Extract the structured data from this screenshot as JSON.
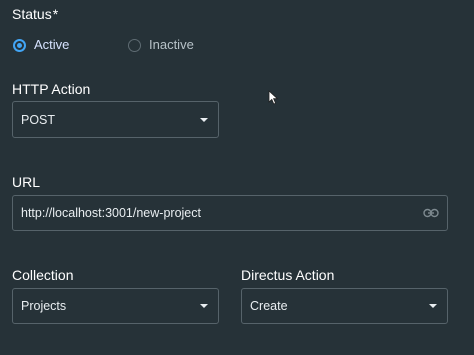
{
  "status": {
    "label": "Status",
    "required_mark": "*",
    "options": [
      {
        "label": "Active",
        "selected": true
      },
      {
        "label": "Inactive",
        "selected": false
      }
    ]
  },
  "http_action": {
    "label": "HTTP Action",
    "value": "POST"
  },
  "url": {
    "label": "URL",
    "value": "http://localhost:3001/new-project"
  },
  "collection": {
    "label": "Collection",
    "value": "Projects"
  },
  "directus_action": {
    "label": "Directus Action",
    "value": "Create"
  },
  "icons": {
    "caret": "chevron-down-icon",
    "url_suffix": "link-icon",
    "cursor": "mouse-pointer-icon"
  },
  "colors": {
    "background": "#263238",
    "accent": "#42a5f5",
    "border": "#56636a"
  }
}
